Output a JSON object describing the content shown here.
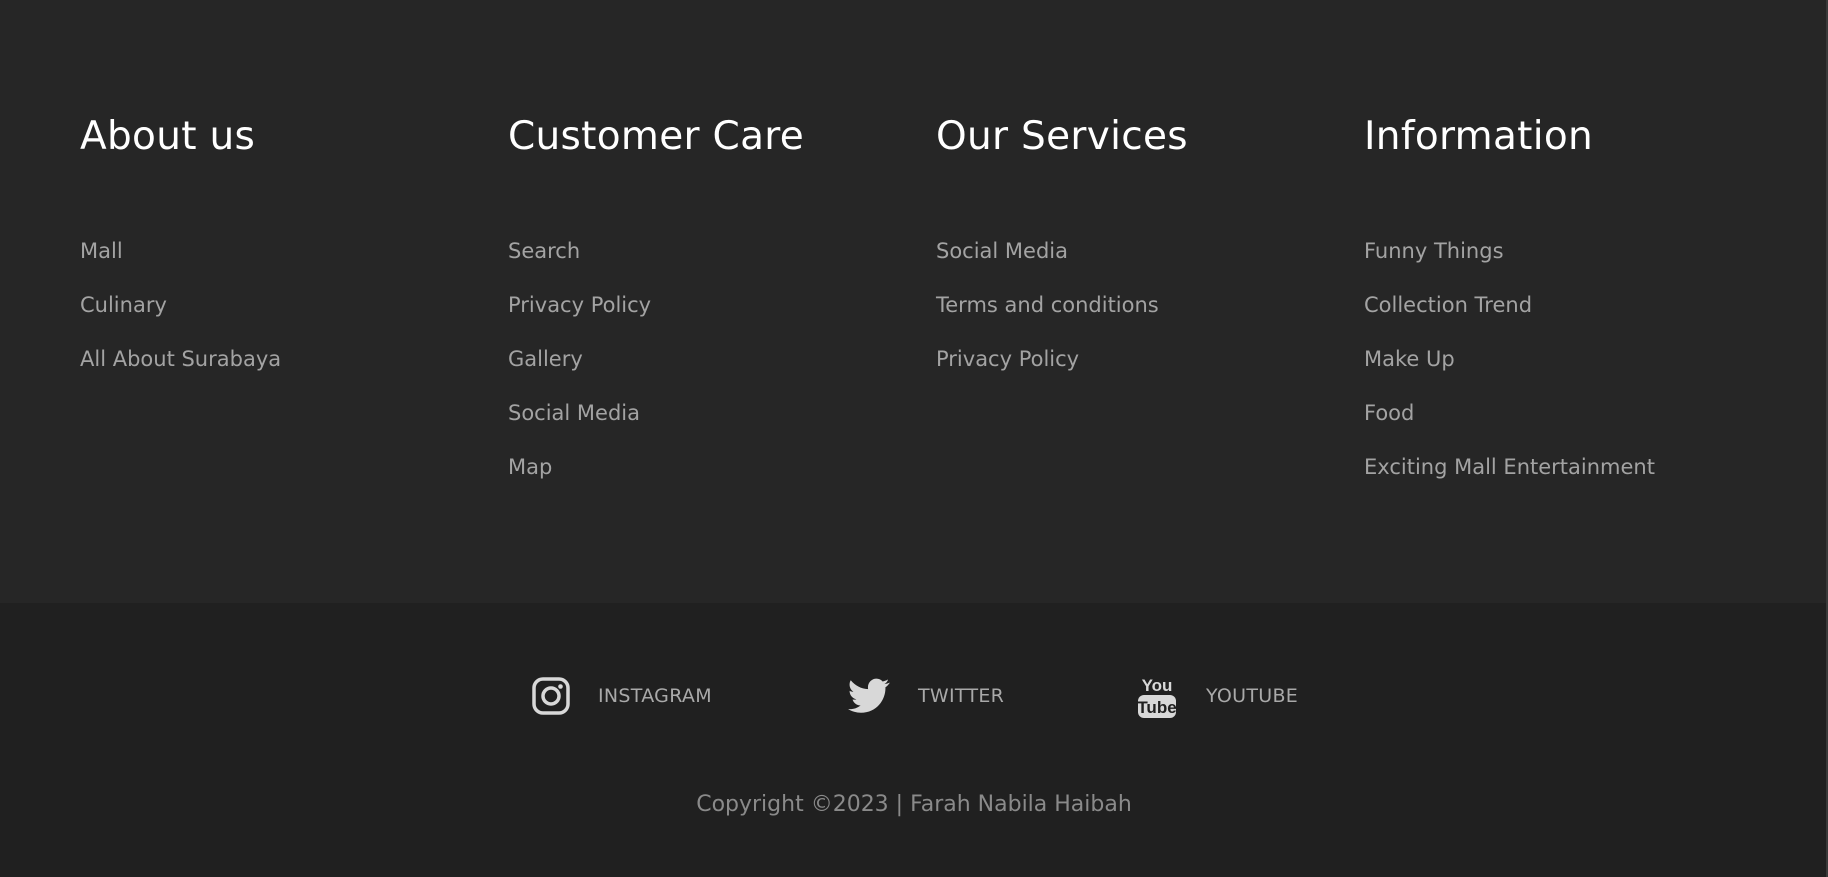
{
  "columns": [
    {
      "title": "About us",
      "links": [
        "Mall",
        "Culinary",
        "All About Surabaya"
      ]
    },
    {
      "title": "Customer Care",
      "links": [
        "Search",
        "Privacy Policy",
        "Gallery",
        "Social Media",
        "Map"
      ]
    },
    {
      "title": "Our Services",
      "links": [
        "Social Media",
        "Terms and conditions",
        "Privacy Policy"
      ]
    },
    {
      "title": "Information",
      "links": [
        "Funny Things",
        "Collection Trend",
        "Make Up",
        "Food",
        "Exciting Mall Entertainment"
      ]
    }
  ],
  "social": [
    {
      "label": "INSTAGRAM",
      "icon": "instagram-icon"
    },
    {
      "label": "TWITTER",
      "icon": "twitter-icon"
    },
    {
      "label": "YOUTUBE",
      "icon": "youtube-icon"
    }
  ],
  "copyright": "Copyright ©2023 | Farah Nabila Haibah",
  "colors": {
    "top_bg": "#262626",
    "bottom_bg": "#202020",
    "heading": "#ffffff",
    "link": "#a3a3a3"
  }
}
